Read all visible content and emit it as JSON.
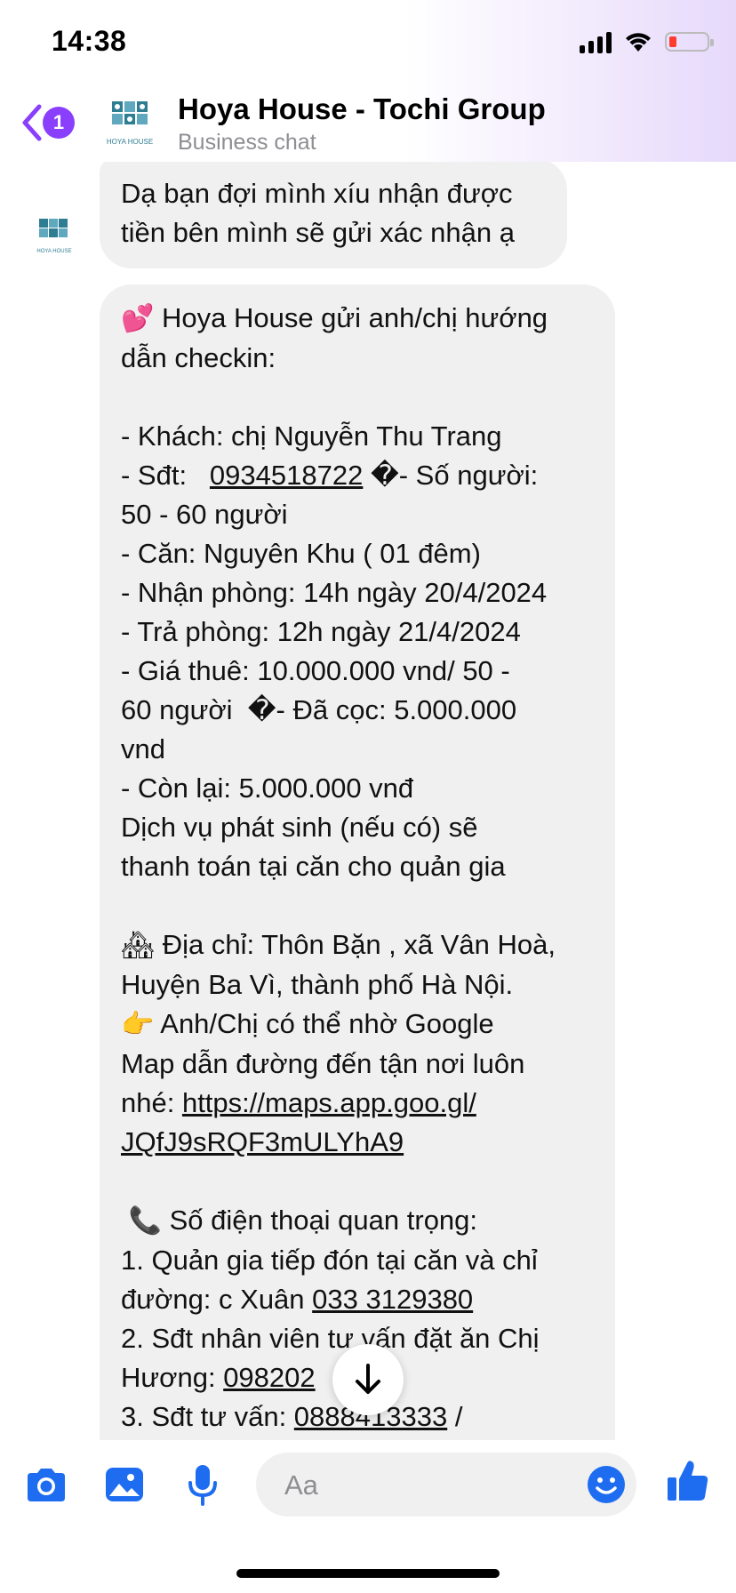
{
  "status_bar": {
    "time": "14:38"
  },
  "header": {
    "back_badge": "1",
    "title": "Hoya House - Tochi Group",
    "subtitle": "Business chat",
    "avatar_text": "HOYA HOUSE"
  },
  "messages": {
    "msg1": {
      "line1": "Dạ bạn đợi mình xíu nhận được",
      "line2": "tiền bên mình sẽ gửi xác nhận ạ"
    },
    "msg2": {
      "l1_emoji": "💕",
      "l1": " Hoya House gửi anh/chị hướng",
      "l2": "dẫn checkin:",
      "l3": "- Khách: chị Nguyễn Thu Trang",
      "l4a": "- Sđt:   ",
      "l4_phone": "0934518722",
      "l4b": " �- Số người:",
      "l5": "50 - 60 người",
      "l6": "- Căn: Nguyên Khu ( 01 đêm)",
      "l7": "- Nhận phòng: 14h ngày 20/4/2024",
      "l8": "- Trả phòng: 12h ngày 21/4/2024",
      "l9": "- Giá thuê: 10.000.000 vnd/ 50 -",
      "l10": "60 người  �- Đã cọc: 5.000.000",
      "l11": "vnd",
      "l12": "- Còn lại: 5.000.000 vnđ",
      "l13": "Dịch vụ phát sinh (nếu có) sẽ",
      "l14": "thanh toán tại căn cho quản gia",
      "l15_emoji": "🏘",
      "l15": " Địa chỉ: Thôn Bặn , xã Vân Hoà,",
      "l16": "Huyện Ba Vì, thành phố Hà Nội.",
      "l17_emoji": "👉",
      "l17": " Anh/Chị có thể nhờ Google",
      "l18": "Map dẫn đường đến tận nơi luôn",
      "l19a": "nhé: ",
      "l19_link": "https://maps.app.goo.gl/",
      "l20_link": "JQfJ9sRQF3mULYhA9",
      "l21_emoji": "📞",
      "l21": " Số điện thoại quan trọng:",
      "l22": "1. Quản gia tiếp đón tại căn và chỉ",
      "l23a": "đường: c Xuân ",
      "l23_phone": "033 3129380",
      "l24": "2. Sđt nhân viên tư vấn đặt ăn Chị",
      "l25a": "Hương: ",
      "l25_phone": "098202",
      "l26a": "3. Sđt tư vấn: ",
      "l26_phone": "0888413333",
      "l26b": " /"
    }
  },
  "composer": {
    "placeholder": "Aa"
  },
  "icons": {
    "camera": "camera-icon",
    "photo": "photo-icon",
    "mic": "microphone-icon",
    "emoji": "emoji-icon",
    "like": "thumbs-up-icon",
    "scroll_down": "arrow-down-icon"
  },
  "colors": {
    "accent": "#8a3ffc",
    "composer_icon": "#1e6df0",
    "bubble": "#f0f0f0"
  }
}
